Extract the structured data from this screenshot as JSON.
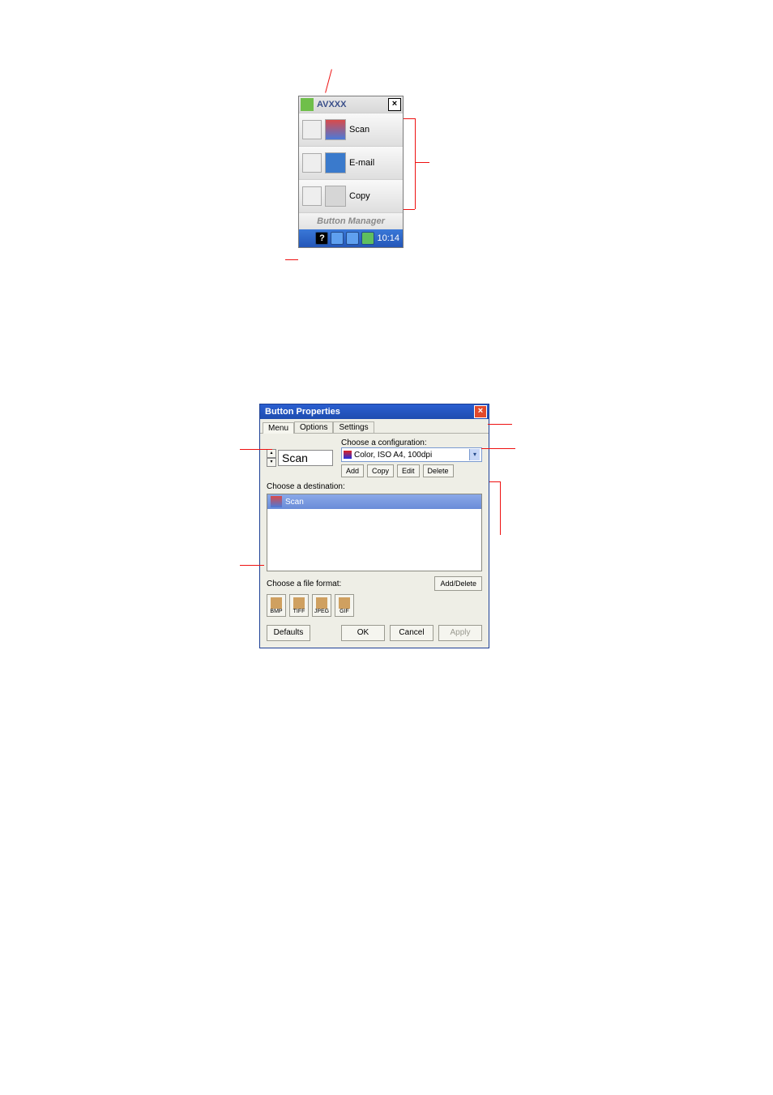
{
  "top_panel": {
    "title": "AVXXX",
    "items": [
      {
        "label": "Scan"
      },
      {
        "label": "E-mail"
      },
      {
        "label": "Copy"
      }
    ],
    "footer": "Button Manager",
    "tray": {
      "help_glyph": "?",
      "time": "10:14"
    }
  },
  "dialog": {
    "title": "Button Properties",
    "tabs": [
      "Menu",
      "Options",
      "Settings"
    ],
    "scan_label": "Scan",
    "choose_config_label": "Choose a configuration:",
    "config_selected": "Color, ISO A4, 100dpi",
    "config_buttons": [
      "Add",
      "Copy",
      "Edit",
      "Delete"
    ],
    "choose_dest_label": "Choose a destination:",
    "dest_item": "Scan",
    "choose_ff_label": "Choose a file format:",
    "add_delete": "Add/Delete",
    "formats": [
      "BMP",
      "TIFF",
      "JPEG",
      "GIF"
    ],
    "bottom": {
      "defaults": "Defaults",
      "ok": "OK",
      "cancel": "Cancel",
      "apply": "Apply"
    }
  }
}
